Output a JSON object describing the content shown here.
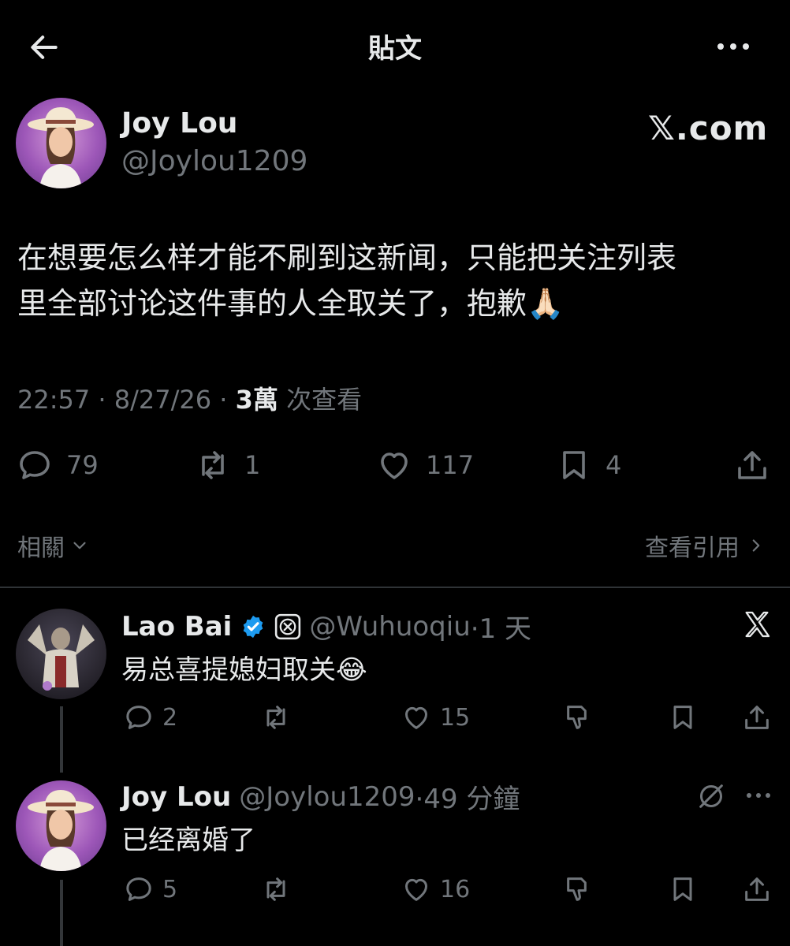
{
  "header": {
    "title": "貼文",
    "back_icon": "back-arrow-icon",
    "more_icon": "more-dots-icon"
  },
  "post": {
    "author_name": "Joy Lou",
    "author_handle": "@Joylou1209",
    "watermark": "𝕏.com",
    "text_line1": "在想要怎么样才能不刷到这新闻，只能把关注列表",
    "text_line2": "里全部讨论这件事的人全取关了，抱歉🙏🏻",
    "time": "22:57",
    "date": "8/27/26",
    "sep": "·",
    "views_count": "3萬",
    "views_label": " 次查看",
    "stats": {
      "replies": "79",
      "reposts": "1",
      "likes": "117",
      "bookmarks": "4"
    },
    "related_label": "相關",
    "quotes_label": "查看引用"
  },
  "replies": [
    {
      "name": "Lao Bai",
      "handle": "@Wuhuoqiu",
      "time": "·1 天",
      "text": "易总喜提媳妇取关😂",
      "stats": {
        "replies": "2",
        "reposts": "",
        "likes": "15"
      },
      "verified": true,
      "badge_icon": "affiliate-badge-icon"
    },
    {
      "name": "Joy Lou",
      "handle": "@Joylou1209",
      "time": "·49 分鐘",
      "text": "已经离婚了",
      "stats": {
        "replies": "5",
        "reposts": "",
        "likes": "16"
      }
    }
  ],
  "colors": {
    "background": "#000000",
    "text": "#e7e9ea",
    "muted": "#71767b",
    "verified": "#1d9bf0",
    "divider": "#2f3336"
  }
}
